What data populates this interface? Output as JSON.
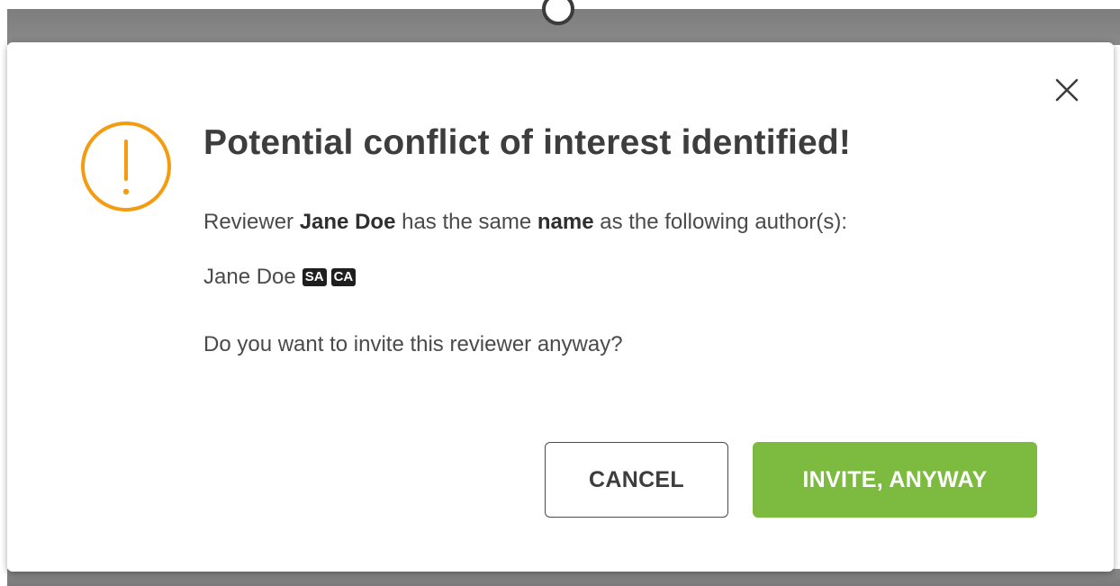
{
  "dialog": {
    "title": "Potential conflict of interest identified!",
    "desc_prefix": "Reviewer ",
    "reviewer_name": "Jane Doe",
    "desc_middle": " has the same ",
    "match_field": "name",
    "desc_suffix": " as the following author(s):",
    "authors": [
      {
        "name": "Jane Doe",
        "badges": [
          "SA",
          "CA"
        ]
      }
    ],
    "question": "Do you want to invite this reviewer anyway?",
    "cancel_label": "CANCEL",
    "invite_label": "INVITE, ANYWAY",
    "close_icon": "close-icon",
    "warning_icon": "warning-icon"
  },
  "colors": {
    "warning": "#f39c12",
    "primary_button": "#7cbb3f",
    "badge_bg": "#1f1f1f",
    "backdrop": "#808080"
  }
}
